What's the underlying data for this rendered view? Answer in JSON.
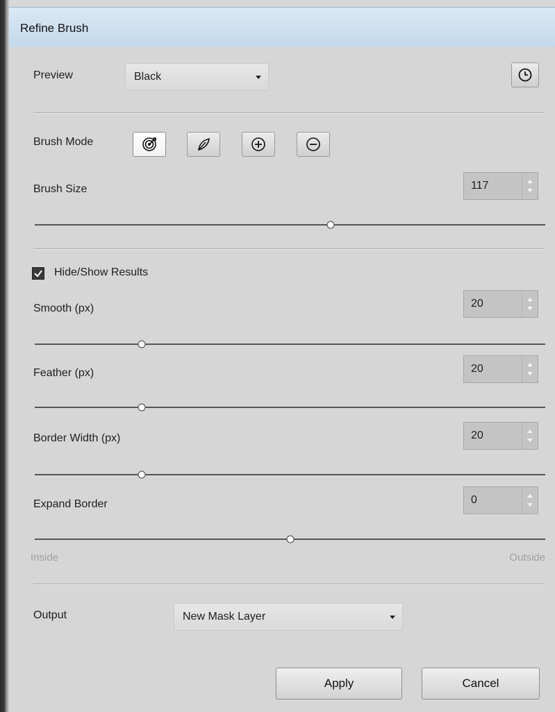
{
  "window": {
    "title": "Refine Brush"
  },
  "preview": {
    "label": "Preview",
    "value": "Black",
    "history_icon": "clock-icon"
  },
  "brush_mode": {
    "label": "Brush Mode",
    "modes": [
      {
        "icon": "target-icon",
        "active": true
      },
      {
        "icon": "leaf-brush-icon",
        "active": false
      },
      {
        "icon": "plus-circle-icon",
        "active": false
      },
      {
        "icon": "minus-circle-icon",
        "active": false
      }
    ]
  },
  "brush_size": {
    "label": "Brush Size",
    "value": "117",
    "slider_fraction": 0.58
  },
  "results": {
    "label": "Hide/Show Results",
    "checked": true
  },
  "smooth": {
    "label": "Smooth (px)",
    "value": "20",
    "slider_fraction": 0.21
  },
  "feather": {
    "label": "Feather (px)",
    "value": "20",
    "slider_fraction": 0.21
  },
  "border_width": {
    "label": "Border Width (px)",
    "value": "20",
    "slider_fraction": 0.21
  },
  "expand_border": {
    "label": "Expand Border",
    "value": "0",
    "slider_fraction": 0.5,
    "min_label": "Inside",
    "max_label": "Outside"
  },
  "output": {
    "label": "Output",
    "value": "New Mask Layer"
  },
  "buttons": {
    "apply": "Apply",
    "cancel": "Cancel"
  }
}
